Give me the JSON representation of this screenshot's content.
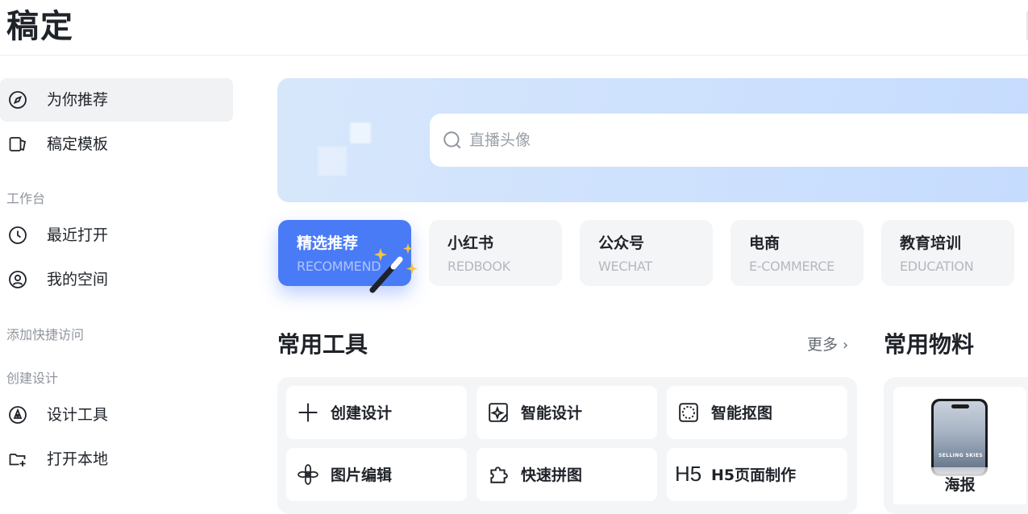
{
  "header": {
    "logo": "稿定"
  },
  "sidebar": {
    "items": [
      {
        "label": "为你推荐",
        "icon": "compass-icon",
        "active": true
      },
      {
        "label": "稿定模板",
        "icon": "template-icon",
        "active": false
      }
    ],
    "workspace_label": "工作台",
    "workspace_items": [
      {
        "label": "最近打开",
        "icon": "clock-icon"
      },
      {
        "label": "我的空间",
        "icon": "user-circle-icon"
      }
    ],
    "quick_access_label": "添加快捷访问",
    "create_label": "创建设计",
    "create_items": [
      {
        "label": "设计工具",
        "icon": "pen-nib-icon"
      },
      {
        "label": "打开本地",
        "icon": "folder-plus-icon"
      }
    ]
  },
  "search": {
    "placeholder": "直播头像"
  },
  "categories": [
    {
      "title": "精选推荐",
      "subtitle": "RECOMMEND",
      "active": true
    },
    {
      "title": "小红书",
      "subtitle": "REDBOOK",
      "active": false
    },
    {
      "title": "公众号",
      "subtitle": "WECHAT",
      "active": false
    },
    {
      "title": "电商",
      "subtitle": "E-COMMERCE",
      "active": false
    },
    {
      "title": "教育培训",
      "subtitle": "EDUCATION",
      "active": false
    }
  ],
  "tools_section": {
    "title": "常用工具",
    "more_label": "更多",
    "tools": [
      {
        "label": "创建设计",
        "icon": "plus-icon"
      },
      {
        "label": "智能设计",
        "icon": "smart-design-icon"
      },
      {
        "label": "智能抠图",
        "icon": "cutout-icon"
      },
      {
        "label": "图片编辑",
        "icon": "aperture-icon"
      },
      {
        "label": "快速拼图",
        "icon": "puzzle-icon"
      },
      {
        "label": "H5页面制作",
        "icon": "h5-icon",
        "glyph": "H5"
      }
    ]
  },
  "materials_section": {
    "title": "常用物料",
    "items": [
      {
        "label": "海报",
        "poster_caption": "SELLING SKIES"
      }
    ]
  },
  "colors": {
    "accent": "#4a7bf7",
    "banner": "#cfe2fd",
    "panel": "#f4f5f7"
  }
}
